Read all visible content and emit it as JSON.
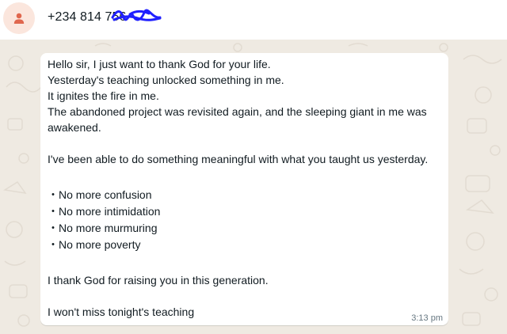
{
  "contact": {
    "phone": "+234 814 756"
  },
  "message": {
    "lines": [
      "Hello sir, I just want to thank God for your life.",
      "Yesterday's teaching unlocked something in me.",
      "It ignites the fire in me.",
      "The abandoned project was revisited again, and the sleeping giant in me was",
      "awakened.",
      "I've been able to do something meaningful with what you taught us yesterday.",
      "・No more confusion",
      "・No more intimidation",
      "・No more murmuring",
      "・No more poverty",
      "I thank God for raising you in this generation.",
      "I won't miss tonight's teaching"
    ],
    "time": "3:13 pm"
  },
  "colors": {
    "background": "#efeae2",
    "bubble": "#ffffff",
    "avatar_bg": "#fbe6dd",
    "avatar_icon": "#e0674e",
    "redaction": "#2020ff"
  },
  "icons": {
    "avatar": "person-icon"
  }
}
